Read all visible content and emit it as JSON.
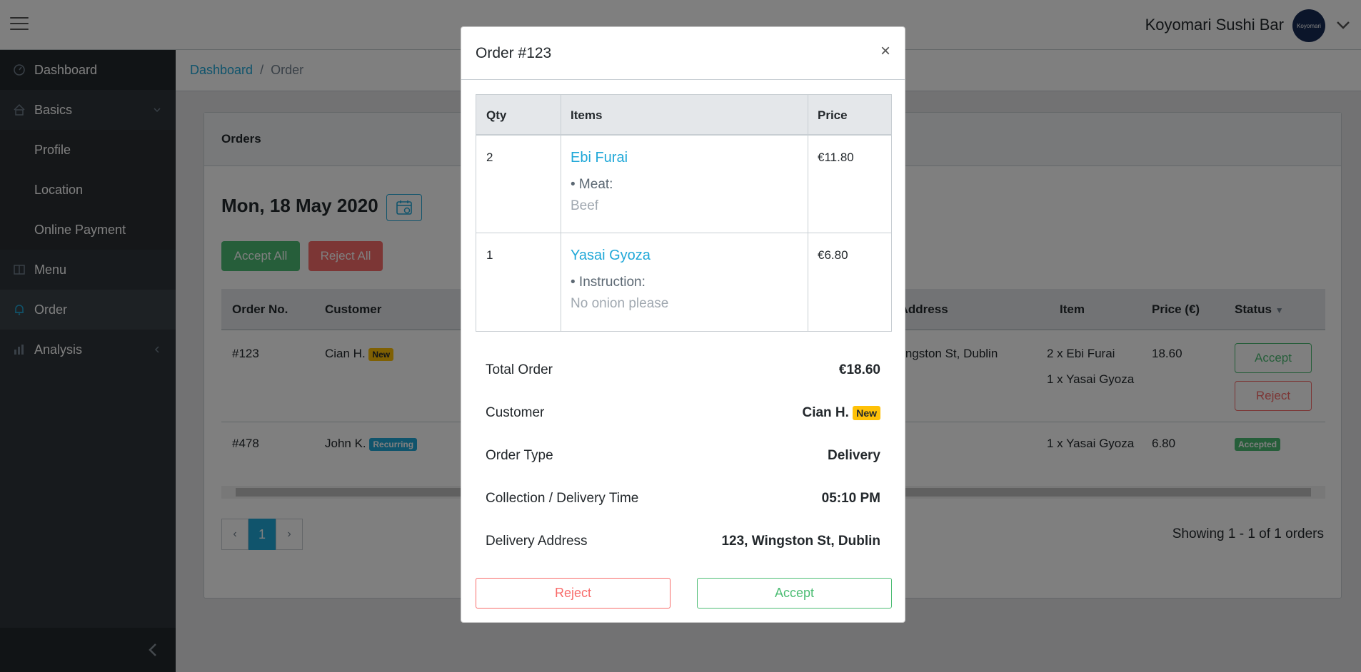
{
  "header": {
    "brand": "Koyomari Sushi Bar",
    "avatar_text": "Koyomari"
  },
  "sidebar": {
    "items": [
      {
        "label": "Dashboard",
        "icon": "speedometer-icon"
      },
      {
        "label": "Basics",
        "icon": "home-icon"
      },
      {
        "label": "Profile"
      },
      {
        "label": "Location"
      },
      {
        "label": "Online Payment"
      },
      {
        "label": "Menu",
        "icon": "book-icon"
      },
      {
        "label": "Order",
        "icon": "bell-icon"
      },
      {
        "label": "Analysis",
        "icon": "chart-icon"
      }
    ]
  },
  "breadcrumb": {
    "link": "Dashboard",
    "separator": "/",
    "current": "Order"
  },
  "card": {
    "title": "Orders",
    "date": "Mon, 18 May 2020",
    "accept_all": "Accept All",
    "reject_all": "Reject All",
    "table": {
      "headers": [
        "Order No.",
        "Customer",
        "ery Address",
        "Item",
        "Price (€)",
        "Status"
      ],
      "rows": [
        {
          "order": "#123",
          "customer": "Cian H.",
          "badge": "New",
          "address": "Wingston St, Dublin",
          "item1": "2 x Ebi Furai",
          "item2": "1 x Yasai Gyoza",
          "price": "18.60",
          "accept": "Accept",
          "reject": "Reject"
        },
        {
          "order": "#478",
          "customer": "John K.",
          "badge": "Recurring",
          "item1": "1 x Yasai Gyoza",
          "price": "6.80",
          "status": "Accepted"
        }
      ]
    },
    "pager": {
      "prev": "‹",
      "page": "1",
      "next": "›"
    },
    "showing": "Showing 1 - 1 of 1 orders"
  },
  "modal": {
    "title": "Order #123",
    "close": "×",
    "table": {
      "headers": [
        "Qty",
        "Items",
        "Price"
      ],
      "rows": [
        {
          "qty": "2",
          "name": "Ebi Furai",
          "opt": "• Meat:",
          "val": "Beef",
          "price": "€11.80"
        },
        {
          "qty": "1",
          "name": "Yasai Gyoza",
          "opt": "• Instruction:",
          "val": "No onion please",
          "price": "€6.80"
        }
      ]
    },
    "summary": {
      "total_label": "Total Order",
      "total": "€18.60",
      "customer_label": "Customer",
      "customer": "Cian H.",
      "customer_badge": "New",
      "type_label": "Order Type",
      "type": "Delivery",
      "time_label": "Collection / Delivery Time",
      "time": "05:10 PM",
      "address_label": "Delivery Address",
      "address": "123, Wingston St, Dublin"
    },
    "reject": "Reject",
    "accept": "Accept"
  }
}
